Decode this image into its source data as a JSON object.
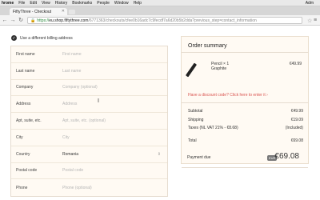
{
  "menubar": {
    "app": "hrome",
    "items": [
      "File",
      "Edit",
      "View",
      "History",
      "Bookmarks",
      "People",
      "Window",
      "Help"
    ],
    "right": "Adm"
  },
  "tab": {
    "title": "FiftyThree - Checkout"
  },
  "url": {
    "scheme": "https://",
    "host": "eu.shop.fiftythree.com",
    "path": "/6771363/checkouts/cfee0b16adc7c9fecdf7a6d20b5b2dda?previous_step=contact_information"
  },
  "checkout": {
    "billing_label": "Use a different billing address"
  },
  "form": {
    "fields": [
      {
        "label": "First name",
        "value": "First name",
        "filled": false
      },
      {
        "label": "Last name",
        "value": "Last name",
        "filled": false
      },
      {
        "label": "Company",
        "value": "Company (optional)",
        "filled": false
      },
      {
        "label": "Address",
        "value": "Address",
        "filled": false
      },
      {
        "label": "Apt, suite, etc.",
        "value": "Apt, suite, etc. (optional)",
        "filled": false
      },
      {
        "label": "City",
        "value": "City",
        "filled": false
      },
      {
        "label": "Country",
        "value": "Romania",
        "filled": true
      },
      {
        "label": "Postal code",
        "value": "Postal code",
        "filled": false
      },
      {
        "label": "Phone",
        "value": "Phone (optional)",
        "filled": false
      }
    ]
  },
  "summary": {
    "title": "Order summary",
    "product": {
      "name": "Pencil × 1",
      "variant": "Graphite",
      "price": "€49.99"
    },
    "discount": "Have a discount code? Click here to enter it",
    "rows": [
      {
        "label": "Subtotal",
        "value": "€49.99"
      },
      {
        "label": "Shipping",
        "value": "€19.09"
      },
      {
        "label": "Taxes (NL VAT 21% - €8.68)",
        "value": "(Included)"
      },
      {
        "label": "Total",
        "value": "€69.08"
      }
    ],
    "due": {
      "label": "Payment due",
      "currency": "EUR",
      "amount": "€69.08"
    }
  },
  "colors": {
    "accent": "#d9534f",
    "panel_bg": "#fffaf3",
    "border": "#e6dccf",
    "secure": "#2b8a3e"
  }
}
